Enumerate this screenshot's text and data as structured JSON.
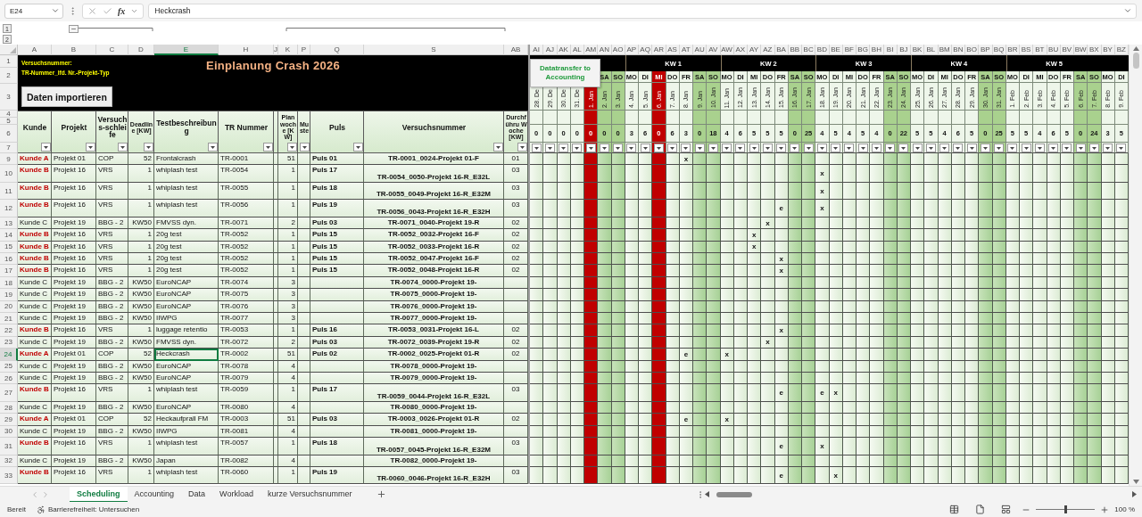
{
  "formula_bar": {
    "cell": "E24",
    "fx": "fx",
    "value": "Heckcrash"
  },
  "outline_levels": [
    "1",
    "2"
  ],
  "columns": [
    {
      "letter": "A",
      "title": "Kunde",
      "selected": false
    },
    {
      "letter": "B",
      "title": "Projekt",
      "selected": false
    },
    {
      "letter": "C",
      "title": "Versuchs-schleife",
      "selected": false
    },
    {
      "letter": "D",
      "title": "Deadline [KW]",
      "selected": false
    },
    {
      "letter": "E",
      "title": "Testbeschreibung",
      "selected": true
    },
    {
      "letter": "H",
      "title": "TR Nummer",
      "selected": false
    },
    {
      "letter": "J",
      "selected": false
    },
    {
      "letter": "K",
      "title": "Plan woche [KW]",
      "selected": false
    },
    {
      "letter": "P",
      "title": "Muste",
      "selected": false
    },
    {
      "letter": "Q",
      "title": "Puls",
      "selected": false
    },
    {
      "letter": "S",
      "title": "Versuchsnummer",
      "selected": false
    },
    {
      "letter": "AB",
      "title": "Durchführu Woche [KW]",
      "selected": false
    }
  ],
  "banner": {
    "note": [
      "Versuchsnummer:",
      "TR-Nummer_lfd. Nr.-Projekt-Typ"
    ],
    "title": "Einplanung Crash 2026",
    "button": "Daten importieren"
  },
  "header_rows": [
    "1",
    "2",
    "3",
    "4",
    "5",
    "6",
    "7"
  ],
  "calendar": {
    "button": "Datatransfer to Accounting",
    "groups": [
      {
        "days": [
          {
            "col": "AI",
            "date": "28. De",
            "count": "0",
            "kind": "weekday"
          },
          {
            "col": "AJ",
            "date": "29. De",
            "count": "0",
            "kind": "weekday"
          },
          {
            "col": "AK",
            "date": "30. De",
            "count": "0",
            "kind": "weekday"
          },
          {
            "col": "AL",
            "date": "31. De",
            "count": "0",
            "kind": "weekday"
          },
          {
            "col": "AM",
            "date": "1. Jan",
            "count": "0",
            "kind": "holiday"
          },
          {
            "col": "AN",
            "day": "SA",
            "date": "2. Jan",
            "count": "0",
            "kind": "weekend"
          },
          {
            "col": "AO",
            "day": "SO",
            "date": "3. Jan",
            "count": "0",
            "kind": "weekend"
          }
        ]
      },
      {
        "label": "KW 1",
        "days": [
          {
            "col": "AP",
            "day": "MO",
            "date": "4. Jan",
            "count": "3",
            "kind": "weekday"
          },
          {
            "col": "AQ",
            "day": "DI",
            "date": "5. Jan",
            "count": "6",
            "kind": "weekday"
          },
          {
            "col": "AR",
            "day": "MI",
            "date": "6. Jan",
            "count": "0",
            "kind": "holiday"
          },
          {
            "col": "AS",
            "day": "DO",
            "date": "7. Jan",
            "count": "6",
            "kind": "weekday"
          },
          {
            "col": "AT",
            "day": "FR",
            "date": "8. Jan",
            "count": "3",
            "kind": "weekday"
          },
          {
            "col": "AU",
            "day": "SA",
            "date": "9. Jan",
            "count": "0",
            "kind": "weekend"
          },
          {
            "col": "AV",
            "day": "SO",
            "date": "10. Jan",
            "count": "18",
            "kind": "weekend"
          }
        ]
      },
      {
        "label": "KW 2",
        "days": [
          {
            "col": "AW",
            "day": "MO",
            "date": "11. Jan",
            "count": "4",
            "kind": "weekday"
          },
          {
            "col": "AX",
            "day": "DI",
            "date": "12. Jan",
            "count": "6",
            "kind": "weekday"
          },
          {
            "col": "AY",
            "day": "MI",
            "date": "13. Jan",
            "count": "5",
            "kind": "weekday"
          },
          {
            "col": "AZ",
            "day": "DO",
            "date": "14. Jan",
            "count": "5",
            "kind": "weekday"
          },
          {
            "col": "BA",
            "day": "FR",
            "date": "15. Jan",
            "count": "5",
            "kind": "weekday"
          },
          {
            "col": "BB",
            "day": "SA",
            "date": "16. Jan",
            "count": "0",
            "kind": "weekend"
          },
          {
            "col": "BC",
            "day": "SO",
            "date": "17. Jan",
            "count": "25",
            "kind": "weekend"
          }
        ]
      },
      {
        "label": "KW 3",
        "days": [
          {
            "col": "BD",
            "day": "MO",
            "date": "18. Jan",
            "count": "4",
            "kind": "weekday"
          },
          {
            "col": "BE",
            "day": "DI",
            "date": "19. Jan",
            "count": "5",
            "kind": "weekday"
          },
          {
            "col": "BF",
            "day": "MI",
            "date": "20. Jan",
            "count": "4",
            "kind": "weekday"
          },
          {
            "col": "BG",
            "day": "DO",
            "date": "21. Jan",
            "count": "5",
            "kind": "weekday"
          },
          {
            "col": "BH",
            "day": "FR",
            "date": "22. Jan",
            "count": "4",
            "kind": "weekday"
          },
          {
            "col": "BI",
            "day": "SA",
            "date": "23. Jan",
            "count": "0",
            "kind": "weekend"
          },
          {
            "col": "BJ",
            "day": "SO",
            "date": "24. Jan",
            "count": "22",
            "kind": "weekend"
          }
        ]
      },
      {
        "label": "KW 4",
        "days": [
          {
            "col": "BK",
            "day": "MO",
            "date": "25. Jan",
            "count": "5",
            "kind": "weekday"
          },
          {
            "col": "BL",
            "day": "DI",
            "date": "26. Jan",
            "count": "5",
            "kind": "weekday"
          },
          {
            "col": "BM",
            "day": "MI",
            "date": "27. Jan",
            "count": "4",
            "kind": "weekday"
          },
          {
            "col": "BN",
            "day": "DO",
            "date": "28. Jan",
            "count": "6",
            "kind": "weekday"
          },
          {
            "col": "BO",
            "day": "FR",
            "date": "29. Jan",
            "count": "5",
            "kind": "weekday"
          },
          {
            "col": "BP",
            "day": "SA",
            "date": "30. Jan",
            "count": "0",
            "kind": "weekend"
          },
          {
            "col": "BQ",
            "day": "SO",
            "date": "31. Jan",
            "count": "25",
            "kind": "weekend"
          }
        ]
      },
      {
        "label": "KW 5",
        "days": [
          {
            "col": "BR",
            "day": "MO",
            "date": "1. Feb",
            "count": "5",
            "kind": "weekday"
          },
          {
            "col": "BS",
            "day": "DI",
            "date": "2. Feb",
            "count": "5",
            "kind": "weekday"
          },
          {
            "col": "BT",
            "day": "MI",
            "date": "3. Feb",
            "count": "4",
            "kind": "weekday"
          },
          {
            "col": "BU",
            "day": "DO",
            "date": "4. Feb",
            "count": "6",
            "kind": "weekday"
          },
          {
            "col": "BV",
            "day": "FR",
            "date": "5. Feb",
            "count": "5",
            "kind": "weekday"
          },
          {
            "col": "BW",
            "day": "SA",
            "date": "6. Feb",
            "count": "0",
            "kind": "weekend"
          },
          {
            "col": "BX",
            "day": "SO",
            "date": "7. Feb",
            "count": "24",
            "kind": "weekend"
          }
        ]
      },
      {
        "days": [
          {
            "col": "BY",
            "day": "MO",
            "date": "8. Feb",
            "count": "3",
            "kind": "weekday"
          },
          {
            "col": "BZ",
            "day": "DI",
            "date": "9. Feb",
            "count": "5",
            "kind": "weekday"
          }
        ]
      }
    ]
  },
  "rows": [
    {
      "num": "9",
      "kind": "single",
      "selected": false,
      "highlight": true,
      "kunde": "Kunde A",
      "projekt": "Projekt 01",
      "schleife": "COP",
      "deadline": "52",
      "test": "Frontalcrash",
      "tr": "TR-0001",
      "plan": "51",
      "puls": "Puls 01",
      "versuch": "TR-0001_0024-Projekt 01-F",
      "woche": "01",
      "schedule": [
        {
          "kind": "blank"
        },
        {
          "kind": "blank"
        },
        {
          "kind": "blank"
        },
        {
          "kind": "blank"
        },
        {
          "kind": "blank"
        },
        {
          "kind": "blank"
        },
        {
          "kind": "blank"
        },
        {
          "kind": "blank"
        },
        {
          "kind": "blank"
        },
        {
          "kind": "blank"
        },
        {
          "kind": "blank"
        },
        {
          "kind": "mark",
          "text": "x"
        }
      ]
    },
    {
      "num": "10",
      "kind": "double",
      "selected": false,
      "highlight": true,
      "kunde": "Kunde B",
      "projekt": "Projekt 16",
      "schleife": "VRS",
      "deadline": "1",
      "test": "whiplash test",
      "tr": "TR-0054",
      "plan": "1",
      "puls": "Puls 17",
      "versuch": "TR-0054_0050-Projekt 16-R_E32L",
      "woche": "03",
      "schedule": [
        {
          "kind": "blank"
        },
        {
          "kind": "blank"
        },
        {
          "kind": "blank"
        },
        {
          "kind": "blank"
        },
        {
          "kind": "blank"
        },
        {
          "kind": "blank"
        },
        {
          "kind": "blank"
        },
        {
          "kind": "blank"
        },
        {
          "kind": "blank"
        },
        {
          "kind": "blank"
        },
        {
          "kind": "blank"
        },
        {
          "kind": "blank"
        },
        {
          "kind": "blank"
        },
        {
          "kind": "blank"
        },
        {
          "kind": "blank"
        },
        {
          "kind": "blank"
        },
        {
          "kind": "blank"
        },
        {
          "kind": "blank"
        },
        {
          "kind": "blank"
        },
        {
          "kind": "blank"
        },
        {
          "kind": "blank"
        },
        {
          "kind": "mark",
          "text": "x"
        }
      ]
    },
    {
      "num": "11",
      "kind": "double",
      "selected": false,
      "highlight": true,
      "kunde": "Kunde B",
      "projekt": "Projekt 16",
      "schleife": "VRS",
      "deadline": "1",
      "test": "whiplash test",
      "tr": "TR-0055",
      "plan": "1",
      "puls": "Puls 18",
      "versuch": "TR-0055_0049-Projekt 16-R_E32M",
      "woche": "03",
      "schedule": [
        {
          "kind": "blank"
        },
        {
          "kind": "blank"
        },
        {
          "kind": "blank"
        },
        {
          "kind": "blank"
        },
        {
          "kind": "blank"
        },
        {
          "kind": "blank"
        },
        {
          "kind": "blank"
        },
        {
          "kind": "blank"
        },
        {
          "kind": "blank"
        },
        {
          "kind": "blank"
        },
        {
          "kind": "blank"
        },
        {
          "kind": "blank"
        },
        {
          "kind": "blank"
        },
        {
          "kind": "blank"
        },
        {
          "kind": "blank"
        },
        {
          "kind": "blank"
        },
        {
          "kind": "blank"
        },
        {
          "kind": "blank"
        },
        {
          "kind": "blank"
        },
        {
          "kind": "blank"
        },
        {
          "kind": "blank"
        },
        {
          "kind": "mark",
          "text": "x"
        }
      ]
    },
    {
      "num": "12",
      "kind": "double",
      "selected": false,
      "highlight": true,
      "kunde": "Kunde B",
      "projekt": "Projekt 16",
      "schleife": "VRS",
      "deadline": "1",
      "test": "whiplash test",
      "tr": "TR-0056",
      "plan": "1",
      "puls": "Puls 19",
      "versuch": "TR-0056_0043-Projekt 16-R_E32H",
      "woche": "03",
      "schedule": [
        {
          "kind": "blank"
        },
        {
          "kind": "blank"
        },
        {
          "kind": "blank"
        },
        {
          "kind": "blank"
        },
        {
          "kind": "blank"
        },
        {
          "kind": "blank"
        },
        {
          "kind": "blank"
        },
        {
          "kind": "blank"
        },
        {
          "kind": "blank"
        },
        {
          "kind": "blank"
        },
        {
          "kind": "blank"
        },
        {
          "kind": "blank"
        },
        {
          "kind": "blank"
        },
        {
          "kind": "blank"
        },
        {
          "kind": "blank"
        },
        {
          "kind": "blank"
        },
        {
          "kind": "blank"
        },
        {
          "kind": "blank"
        },
        {
          "kind": "mark",
          "text": "e"
        },
        {
          "kind": "blank"
        },
        {
          "kind": "blank"
        },
        {
          "kind": "mark",
          "text": "x"
        }
      ]
    },
    {
      "num": "13",
      "kind": "single",
      "selected": false,
      "highlight": false,
      "kunde": "Kunde C",
      "projekt": "Projekt 19",
      "schleife": "BBG - 2",
      "deadline": "KW50",
      "test": "FMVSS dyn.",
      "tr": "TR-0071",
      "plan": "2",
      "puls": "Puls 03",
      "versuch": "TR-0071_0040-Projekt 19-R",
      "woche": "02",
      "schedule": [
        {
          "kind": "blank"
        },
        {
          "kind": "blank"
        },
        {
          "kind": "blank"
        },
        {
          "kind": "blank"
        },
        {
          "kind": "blank"
        },
        {
          "kind": "blank"
        },
        {
          "kind": "blank"
        },
        {
          "kind": "blank"
        },
        {
          "kind": "blank"
        },
        {
          "kind": "blank"
        },
        {
          "kind": "blank"
        },
        {
          "kind": "blank"
        },
        {
          "kind": "blank"
        },
        {
          "kind": "blank"
        },
        {
          "kind": "blank"
        },
        {
          "kind": "blank"
        },
        {
          "kind": "blank"
        },
        {
          "kind": "mark",
          "text": "x"
        }
      ]
    },
    {
      "num": "14",
      "kind": "single",
      "selected": false,
      "highlight": true,
      "kunde": "Kunde B",
      "projekt": "Projekt 16",
      "schleife": "VRS",
      "deadline": "1",
      "test": "20g test",
      "tr": "TR-0052",
      "plan": "1",
      "puls": "Puls 15",
      "versuch": "TR-0052_0032-Projekt 16-F",
      "woche": "02",
      "schedule": [
        {
          "kind": "blank"
        },
        {
          "kind": "blank"
        },
        {
          "kind": "blank"
        },
        {
          "kind": "blank"
        },
        {
          "kind": "blank"
        },
        {
          "kind": "blank"
        },
        {
          "kind": "blank"
        },
        {
          "kind": "blank"
        },
        {
          "kind": "blank"
        },
        {
          "kind": "blank"
        },
        {
          "kind": "blank"
        },
        {
          "kind": "blank"
        },
        {
          "kind": "blank"
        },
        {
          "kind": "blank"
        },
        {
          "kind": "blank"
        },
        {
          "kind": "blank"
        },
        {
          "kind": "mark",
          "text": "x"
        }
      ]
    },
    {
      "num": "15",
      "kind": "single",
      "selected": false,
      "highlight": true,
      "kunde": "Kunde B",
      "projekt": "Projekt 16",
      "schleife": "VRS",
      "deadline": "1",
      "test": "20g test",
      "tr": "TR-0052",
      "plan": "1",
      "puls": "Puls 15",
      "versuch": "TR-0052_0033-Projekt 16-R",
      "woche": "02",
      "schedule": [
        {
          "kind": "blank"
        },
        {
          "kind": "blank"
        },
        {
          "kind": "blank"
        },
        {
          "kind": "blank"
        },
        {
          "kind": "blank"
        },
        {
          "kind": "blank"
        },
        {
          "kind": "blank"
        },
        {
          "kind": "blank"
        },
        {
          "kind": "blank"
        },
        {
          "kind": "blank"
        },
        {
          "kind": "blank"
        },
        {
          "kind": "blank"
        },
        {
          "kind": "blank"
        },
        {
          "kind": "blank"
        },
        {
          "kind": "blank"
        },
        {
          "kind": "blank"
        },
        {
          "kind": "mark",
          "text": "x"
        }
      ]
    },
    {
      "num": "16",
      "kind": "single",
      "selected": false,
      "highlight": true,
      "kunde": "Kunde B",
      "projekt": "Projekt 16",
      "schleife": "VRS",
      "deadline": "1",
      "test": "20g test",
      "tr": "TR-0052",
      "plan": "1",
      "puls": "Puls 15",
      "versuch": "TR-0052_0047-Projekt 16-F",
      "woche": "02",
      "schedule": [
        {
          "kind": "blank"
        },
        {
          "kind": "blank"
        },
        {
          "kind": "blank"
        },
        {
          "kind": "blank"
        },
        {
          "kind": "blank"
        },
        {
          "kind": "blank"
        },
        {
          "kind": "blank"
        },
        {
          "kind": "blank"
        },
        {
          "kind": "blank"
        },
        {
          "kind": "blank"
        },
        {
          "kind": "blank"
        },
        {
          "kind": "blank"
        },
        {
          "kind": "blank"
        },
        {
          "kind": "blank"
        },
        {
          "kind": "blank"
        },
        {
          "kind": "blank"
        },
        {
          "kind": "blank"
        },
        {
          "kind": "blank"
        },
        {
          "kind": "mark",
          "text": "x"
        }
      ]
    },
    {
      "num": "17",
      "kind": "single",
      "selected": false,
      "highlight": true,
      "kunde": "Kunde B",
      "projekt": "Projekt 16",
      "schleife": "VRS",
      "deadline": "1",
      "test": "20g test",
      "tr": "TR-0052",
      "plan": "1",
      "puls": "Puls 15",
      "versuch": "TR-0052_0048-Projekt 16-R",
      "woche": "02",
      "schedule": [
        {
          "kind": "blank"
        },
        {
          "kind": "blank"
        },
        {
          "kind": "blank"
        },
        {
          "kind": "blank"
        },
        {
          "kind": "blank"
        },
        {
          "kind": "blank"
        },
        {
          "kind": "blank"
        },
        {
          "kind": "blank"
        },
        {
          "kind": "blank"
        },
        {
          "kind": "blank"
        },
        {
          "kind": "blank"
        },
        {
          "kind": "blank"
        },
        {
          "kind": "blank"
        },
        {
          "kind": "blank"
        },
        {
          "kind": "blank"
        },
        {
          "kind": "blank"
        },
        {
          "kind": "blank"
        },
        {
          "kind": "blank"
        },
        {
          "kind": "mark",
          "text": "x"
        }
      ]
    },
    {
      "num": "18",
      "kind": "single",
      "selected": false,
      "highlight": false,
      "kunde": "Kunde C",
      "projekt": "Projekt 19",
      "schleife": "BBG - 2",
      "deadline": "KW50",
      "test": "EuroNCAP",
      "tr": "TR-0074",
      "plan": "3",
      "versuch": "TR-0074_0000-Projekt 19-"
    },
    {
      "num": "19",
      "kind": "single",
      "selected": false,
      "highlight": false,
      "kunde": "Kunde C",
      "projekt": "Projekt 19",
      "schleife": "BBG - 2",
      "deadline": "KW50",
      "test": "EuroNCAP",
      "tr": "TR-0075",
      "plan": "3",
      "versuch": "TR-0075_0000-Projekt 19-"
    },
    {
      "num": "20",
      "kind": "single",
      "selected": false,
      "highlight": false,
      "kunde": "Kunde C",
      "projekt": "Projekt 19",
      "schleife": "BBG - 2",
      "deadline": "KW50",
      "test": "EuroNCAP",
      "tr": "TR-0076",
      "plan": "3",
      "versuch": "TR-0076_0000-Projekt 19-"
    },
    {
      "num": "21",
      "kind": "single",
      "selected": false,
      "highlight": false,
      "kunde": "Kunde C",
      "projekt": "Projekt 19",
      "schleife": "BBG - 2",
      "deadline": "KW50",
      "test": "IIWPG",
      "tr": "TR-0077",
      "plan": "3",
      "versuch": "TR-0077_0000-Projekt 19-"
    },
    {
      "num": "22",
      "kind": "single",
      "selected": false,
      "highlight": true,
      "kunde": "Kunde B",
      "projekt": "Projekt 16",
      "schleife": "VRS",
      "deadline": "1",
      "test": "luggage retentio",
      "tr": "TR-0053",
      "plan": "1",
      "puls": "Puls 16",
      "versuch": "TR-0053_0031-Projekt 16-L",
      "woche": "02",
      "schedule": [
        {
          "kind": "blank"
        },
        {
          "kind": "blank"
        },
        {
          "kind": "blank"
        },
        {
          "kind": "blank"
        },
        {
          "kind": "blank"
        },
        {
          "kind": "blank"
        },
        {
          "kind": "blank"
        },
        {
          "kind": "blank"
        },
        {
          "kind": "blank"
        },
        {
          "kind": "blank"
        },
        {
          "kind": "blank"
        },
        {
          "kind": "blank"
        },
        {
          "kind": "blank"
        },
        {
          "kind": "blank"
        },
        {
          "kind": "blank"
        },
        {
          "kind": "blank"
        },
        {
          "kind": "blank"
        },
        {
          "kind": "blank"
        },
        {
          "kind": "mark",
          "text": "x"
        }
      ]
    },
    {
      "num": "23",
      "kind": "single",
      "selected": false,
      "highlight": false,
      "kunde": "Kunde C",
      "projekt": "Projekt 19",
      "schleife": "BBG - 2",
      "deadline": "KW50",
      "test": "FMVSS dyn.",
      "tr": "TR-0072",
      "plan": "2",
      "puls": "Puls 03",
      "versuch": "TR-0072_0039-Projekt 19-R",
      "woche": "02",
      "schedule": [
        {
          "kind": "blank"
        },
        {
          "kind": "blank"
        },
        {
          "kind": "blank"
        },
        {
          "kind": "blank"
        },
        {
          "kind": "blank"
        },
        {
          "kind": "blank"
        },
        {
          "kind": "blank"
        },
        {
          "kind": "blank"
        },
        {
          "kind": "blank"
        },
        {
          "kind": "blank"
        },
        {
          "kind": "blank"
        },
        {
          "kind": "blank"
        },
        {
          "kind": "blank"
        },
        {
          "kind": "blank"
        },
        {
          "kind": "blank"
        },
        {
          "kind": "blank"
        },
        {
          "kind": "blank"
        },
        {
          "kind": "mark",
          "text": "x"
        }
      ]
    },
    {
      "num": "24",
      "kind": "single",
      "selected": true,
      "highlight": true,
      "kunde": "Kunde A",
      "projekt": "Projekt 01",
      "schleife": "COP",
      "deadline": "52",
      "test": "Heckcrash",
      "tr": "TR-0002",
      "plan": "51",
      "puls": "Puls 02",
      "versuch": "TR-0002_0025-Projekt 01-R",
      "woche": "02",
      "schedule": [
        {
          "kind": "blank"
        },
        {
          "kind": "blank"
        },
        {
          "kind": "blank"
        },
        {
          "kind": "blank"
        },
        {
          "kind": "blank"
        },
        {
          "kind": "blank"
        },
        {
          "kind": "blank"
        },
        {
          "kind": "blank"
        },
        {
          "kind": "blank"
        },
        {
          "kind": "blank"
        },
        {
          "kind": "blank"
        },
        {
          "kind": "mark",
          "text": "e"
        },
        {
          "kind": "blank"
        },
        {
          "kind": "blank"
        },
        {
          "kind": "mark",
          "text": "x"
        }
      ]
    },
    {
      "num": "25",
      "kind": "single",
      "selected": false,
      "highlight": false,
      "kunde": "Kunde C",
      "projekt": "Projekt 19",
      "schleife": "BBG - 2",
      "deadline": "KW50",
      "test": "EuroNCAP",
      "tr": "TR-0078",
      "plan": "4",
      "versuch": "TR-0078_0000-Projekt 19-"
    },
    {
      "num": "26",
      "kind": "single",
      "selected": false,
      "highlight": false,
      "kunde": "Kunde C",
      "projekt": "Projekt 19",
      "schleife": "BBG - 2",
      "deadline": "KW50",
      "test": "EuroNCAP",
      "tr": "TR-0079",
      "plan": "4",
      "versuch": "TR-0079_0000-Projekt 19-"
    },
    {
      "num": "27",
      "kind": "double",
      "selected": false,
      "highlight": true,
      "kunde": "Kunde B",
      "projekt": "Projekt 16",
      "schleife": "VRS",
      "deadline": "1",
      "test": "whiplash test",
      "tr": "TR-0059",
      "plan": "1",
      "puls": "Puls 17",
      "versuch": "TR-0059_0044-Projekt 16-R_E32L",
      "woche": "03",
      "schedule": [
        {
          "kind": "blank"
        },
        {
          "kind": "blank"
        },
        {
          "kind": "blank"
        },
        {
          "kind": "blank"
        },
        {
          "kind": "blank"
        },
        {
          "kind": "blank"
        },
        {
          "kind": "blank"
        },
        {
          "kind": "blank"
        },
        {
          "kind": "blank"
        },
        {
          "kind": "blank"
        },
        {
          "kind": "blank"
        },
        {
          "kind": "blank"
        },
        {
          "kind": "blank"
        },
        {
          "kind": "blank"
        },
        {
          "kind": "blank"
        },
        {
          "kind": "blank"
        },
        {
          "kind": "blank"
        },
        {
          "kind": "blank"
        },
        {
          "kind": "mark",
          "text": "e"
        },
        {
          "kind": "blank"
        },
        {
          "kind": "blank"
        },
        {
          "kind": "mark",
          "text": "e"
        },
        {
          "kind": "mark",
          "text": "x"
        }
      ]
    },
    {
      "num": "28",
      "kind": "single",
      "selected": false,
      "highlight": false,
      "kunde": "Kunde C",
      "projekt": "Projekt 19",
      "schleife": "BBG - 2",
      "deadline": "KW50",
      "test": "EuroNCAP",
      "tr": "TR-0080",
      "plan": "4",
      "versuch": "TR-0080_0000-Projekt 19-"
    },
    {
      "num": "29",
      "kind": "single",
      "selected": false,
      "highlight": true,
      "kunde": "Kunde A",
      "projekt": "Projekt 01",
      "schleife": "COP",
      "deadline": "52",
      "test": "Heckaufprall FM",
      "tr": "TR-0003",
      "plan": "51",
      "puls": "Puls 03",
      "versuch": "TR-0003_0026-Projekt 01-R",
      "woche": "02",
      "schedule": [
        {
          "kind": "blank"
        },
        {
          "kind": "blank"
        },
        {
          "kind": "blank"
        },
        {
          "kind": "blank"
        },
        {
          "kind": "blank"
        },
        {
          "kind": "blank"
        },
        {
          "kind": "blank"
        },
        {
          "kind": "blank"
        },
        {
          "kind": "blank"
        },
        {
          "kind": "blank"
        },
        {
          "kind": "blank"
        },
        {
          "kind": "mark",
          "text": "e"
        },
        {
          "kind": "blank"
        },
        {
          "kind": "blank"
        },
        {
          "kind": "mark",
          "text": "x"
        }
      ]
    },
    {
      "num": "30",
      "kind": "single",
      "selected": false,
      "highlight": false,
      "kunde": "Kunde C",
      "projekt": "Projekt 19",
      "schleife": "BBG - 2",
      "deadline": "KW50",
      "test": "IIWPG",
      "tr": "TR-0081",
      "plan": "4",
      "versuch": "TR-0081_0000-Projekt 19-"
    },
    {
      "num": "31",
      "kind": "double",
      "selected": false,
      "highlight": true,
      "kunde": "Kunde B",
      "projekt": "Projekt 16",
      "schleife": "VRS",
      "deadline": "1",
      "test": "whiplash test",
      "tr": "TR-0057",
      "plan": "1",
      "puls": "Puls 18",
      "versuch": "TR-0057_0045-Projekt 16-R_E32M",
      "woche": "03",
      "schedule": [
        {
          "kind": "blank"
        },
        {
          "kind": "blank"
        },
        {
          "kind": "blank"
        },
        {
          "kind": "blank"
        },
        {
          "kind": "blank"
        },
        {
          "kind": "blank"
        },
        {
          "kind": "blank"
        },
        {
          "kind": "blank"
        },
        {
          "kind": "blank"
        },
        {
          "kind": "blank"
        },
        {
          "kind": "blank"
        },
        {
          "kind": "blank"
        },
        {
          "kind": "blank"
        },
        {
          "kind": "blank"
        },
        {
          "kind": "blank"
        },
        {
          "kind": "blank"
        },
        {
          "kind": "blank"
        },
        {
          "kind": "blank"
        },
        {
          "kind": "mark",
          "text": "e"
        },
        {
          "kind": "blank"
        },
        {
          "kind": "blank"
        },
        {
          "kind": "mark",
          "text": "x"
        }
      ]
    },
    {
      "num": "32",
      "kind": "single",
      "selected": false,
      "highlight": false,
      "kunde": "Kunde C",
      "projekt": "Projekt 19",
      "schleife": "BBG - 2",
      "deadline": "KW50",
      "test": "Japan",
      "tr": "TR-0082",
      "plan": "4",
      "versuch": "TR-0082_0000-Projekt 19-"
    },
    {
      "num": "33",
      "kind": "double",
      "selected": false,
      "highlight": true,
      "kunde": "Kunde B",
      "projekt": "Projekt 16",
      "schleife": "VRS",
      "deadline": "1",
      "test": "whiplash test",
      "tr": "TR-0060",
      "plan": "1",
      "puls": "Puls 19",
      "versuch": "TR-0060_0046-Projekt 16-R_E32H",
      "woche": "03",
      "schedule": [
        {
          "kind": "blank"
        },
        {
          "kind": "blank"
        },
        {
          "kind": "blank"
        },
        {
          "kind": "blank"
        },
        {
          "kind": "blank"
        },
        {
          "kind": "blank"
        },
        {
          "kind": "blank"
        },
        {
          "kind": "blank"
        },
        {
          "kind": "blank"
        },
        {
          "kind": "blank"
        },
        {
          "kind": "blank"
        },
        {
          "kind": "blank"
        },
        {
          "kind": "blank"
        },
        {
          "kind": "blank"
        },
        {
          "kind": "blank"
        },
        {
          "kind": "blank"
        },
        {
          "kind": "blank"
        },
        {
          "kind": "blank"
        },
        {
          "kind": "mark",
          "text": "e"
        },
        {
          "kind": "blank"
        },
        {
          "kind": "blank"
        },
        {
          "kind": "blank"
        },
        {
          "kind": "mark",
          "text": "x"
        }
      ]
    }
  ],
  "sheet_tabs": [
    {
      "label": "Scheduling",
      "selected": true
    },
    {
      "label": "Accounting",
      "selected": false
    },
    {
      "label": "Data",
      "selected": false
    },
    {
      "label": "Workload",
      "selected": false
    },
    {
      "label": "kurze Versuchsnummer",
      "selected": false
    }
  ],
  "status_bar": {
    "mode": "Bereit",
    "accessibility": "Barrierefreiheit: Untersuchen",
    "zoom_slider": {
      "level": 0.5
    },
    "zoom": "100 %"
  }
}
